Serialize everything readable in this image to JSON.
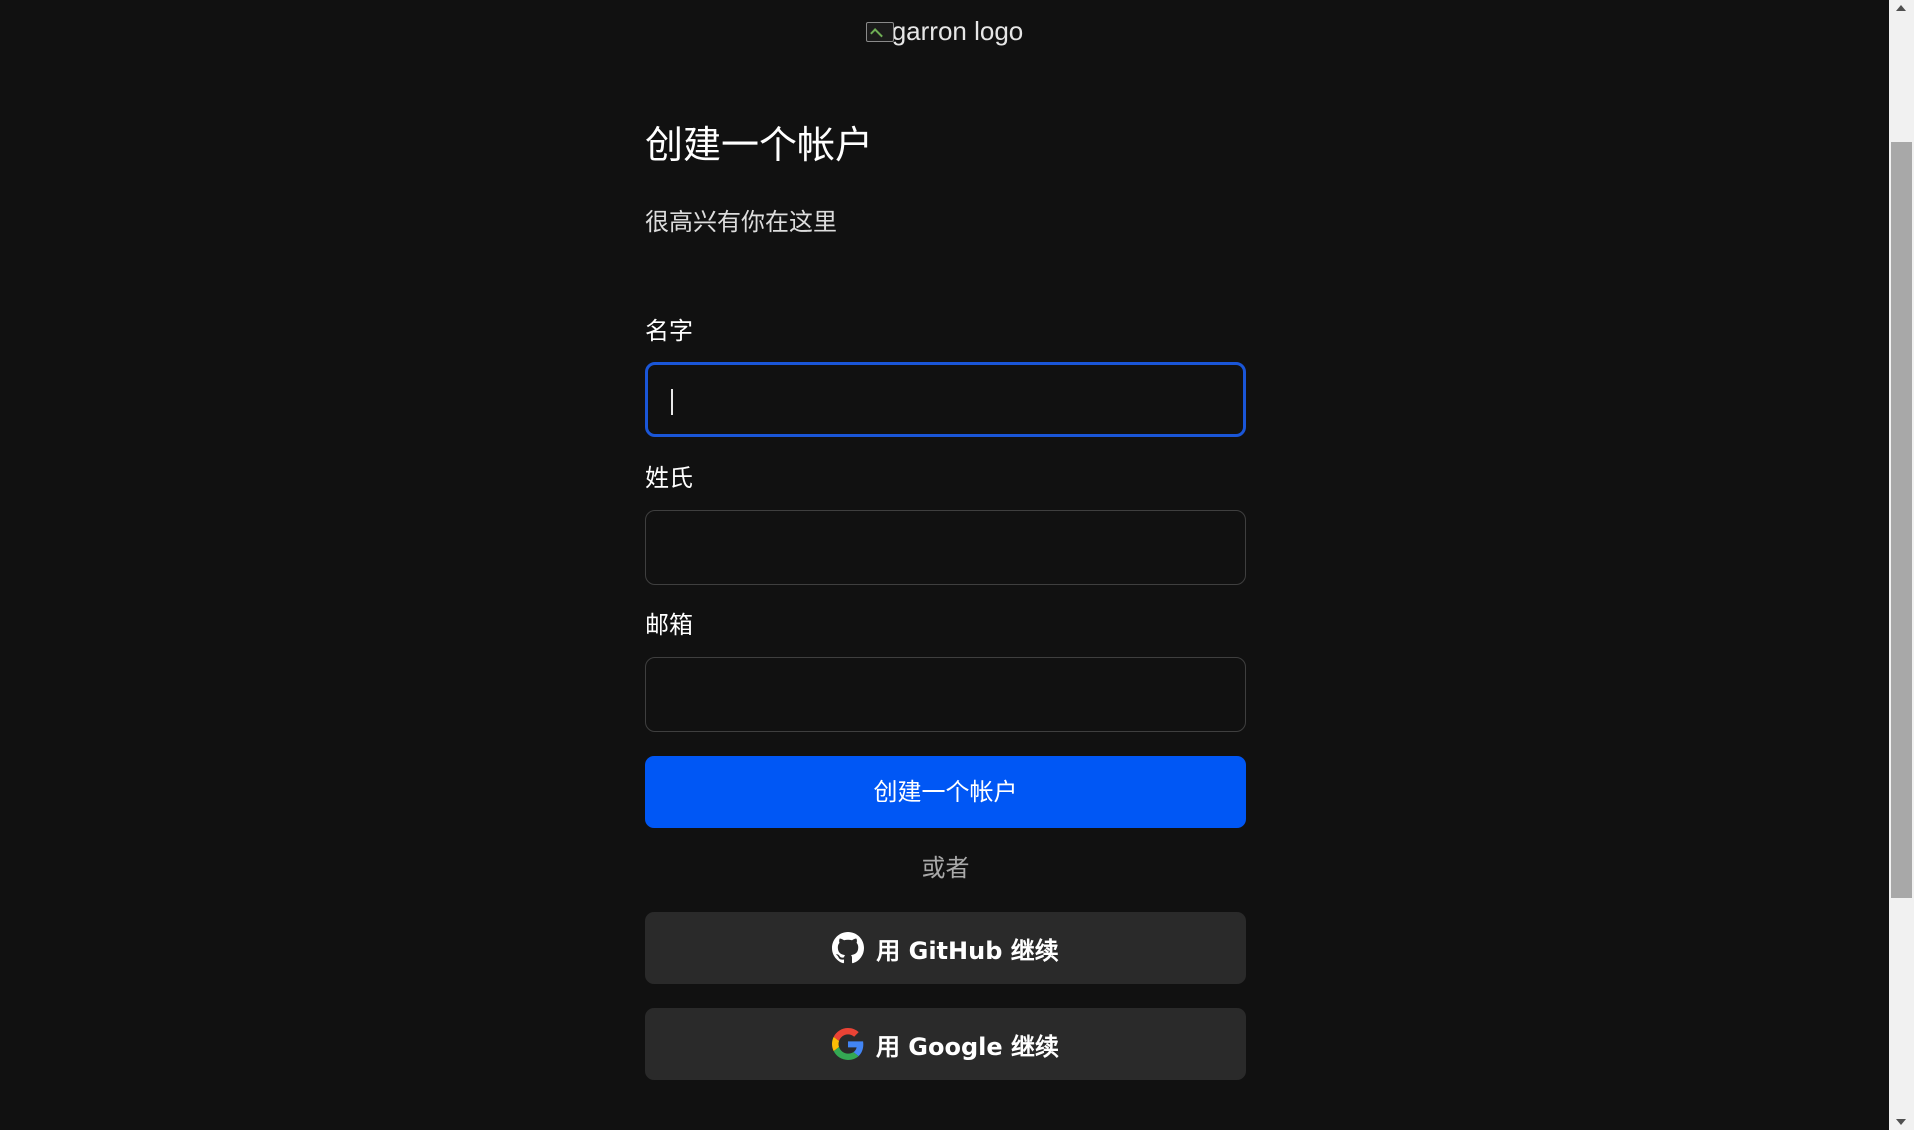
{
  "logo": {
    "alt_text": "garron logo"
  },
  "form": {
    "title": "创建一个帐户",
    "subtitle": "很高兴有你在这里",
    "first_name": {
      "label": "名字",
      "value": ""
    },
    "last_name": {
      "label": "姓氏",
      "value": ""
    },
    "email": {
      "label": "邮箱",
      "value": ""
    },
    "submit_label": "创建一个帐户",
    "divider_text": "或者",
    "github_label": "用 GitHub 继续",
    "google_label": "用 Google 继续"
  },
  "colors": {
    "background": "#111111",
    "primary": "#0057f5",
    "focus_ring": "#1a56d8",
    "secondary_button": "#2a2a2a"
  },
  "icons": {
    "github": "github-icon",
    "google": "google-icon"
  }
}
